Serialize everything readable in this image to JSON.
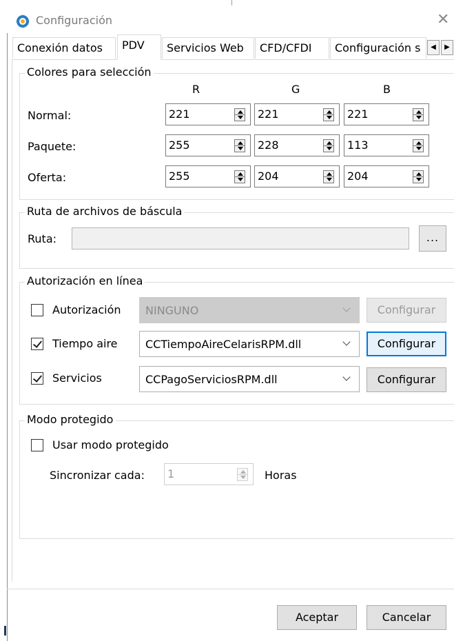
{
  "window": {
    "title": "Configuración",
    "icon": "gear-blue-icon"
  },
  "tabs": [
    {
      "label": "Conexión datos",
      "active": false
    },
    {
      "label": "PDV",
      "active": true
    },
    {
      "label": "Servicios Web",
      "active": false
    },
    {
      "label": "CFD/CFDI",
      "active": false
    },
    {
      "label": "Configuración s",
      "active": false
    }
  ],
  "colores": {
    "legend": "Colores para selección",
    "headers": {
      "r": "R",
      "g": "G",
      "b": "B"
    },
    "rows": [
      {
        "label": "Normal:",
        "r": "221",
        "g": "221",
        "b": "221"
      },
      {
        "label": "Paquete:",
        "r": "255",
        "g": "228",
        "b": "113"
      },
      {
        "label": "Oferta:",
        "r": "255",
        "g": "204",
        "b": "204"
      }
    ]
  },
  "ruta": {
    "legend": "Ruta de archivos de báscula",
    "label": "Ruta:",
    "value": "",
    "browse_label": "..."
  },
  "autorizacion": {
    "legend": "Autorización en línea",
    "rows": [
      {
        "label": "Autorización",
        "checked": false,
        "combo": "NINGUNO",
        "button": "Configurar"
      },
      {
        "label": "Tiempo aire",
        "checked": true,
        "combo": "CCTiempoAireCelarisRPM.dll",
        "button": "Configurar"
      },
      {
        "label": "Servicios",
        "checked": true,
        "combo": "CCPagoServiciosRPM.dll",
        "button": "Configurar"
      }
    ]
  },
  "modo": {
    "legend": "Modo protegido",
    "checkbox_label": "Usar modo protegido",
    "checked": false,
    "sync_label": "Sincronizar cada:",
    "sync_value": "1",
    "unit": "Horas"
  },
  "footer": {
    "accept": "Aceptar",
    "cancel": "Cancelar"
  },
  "colors": {
    "focus_border": "#0078d7",
    "disabled_combo": "#cccccc"
  }
}
